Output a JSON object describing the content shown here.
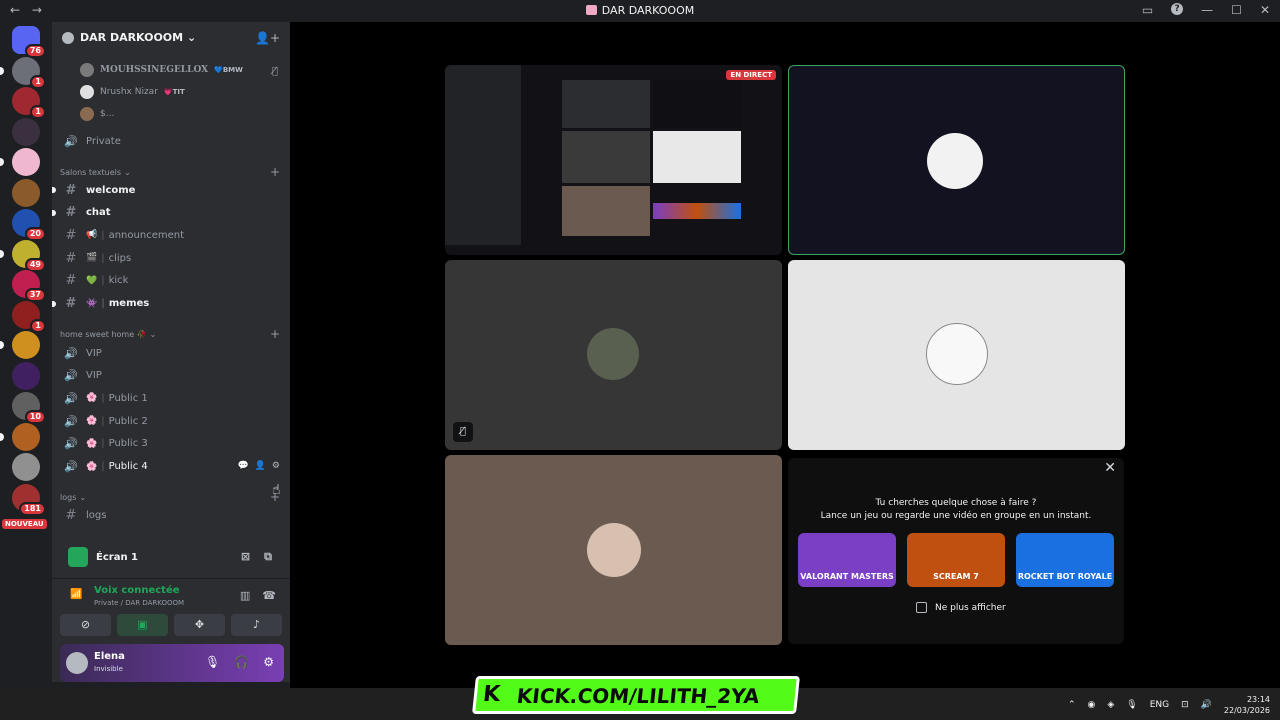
{
  "window": {
    "title": "DAR DARKOOOM",
    "back": "←",
    "forward": "→"
  },
  "servers": [
    {
      "name": "home",
      "badge": "76",
      "color": "#5865f2"
    },
    {
      "name": "server-1",
      "badge": "1",
      "color": "#6d6f78"
    },
    {
      "name": "server-2",
      "badge": "1",
      "color": "#a02830"
    },
    {
      "name": "server-3",
      "badge": "",
      "color": "#3a3040"
    },
    {
      "name": "server-4",
      "badge": "",
      "color": "#f0b8d0"
    },
    {
      "name": "server-5",
      "badge": "",
      "color": "#8a5a2a"
    },
    {
      "name": "server-6",
      "badge": "20",
      "color": "#2050b0"
    },
    {
      "name": "server-7",
      "badge": "49",
      "color": "#c0b030"
    },
    {
      "name": "server-8",
      "badge": "37",
      "color": "#c02050"
    },
    {
      "name": "server-9",
      "badge": "1",
      "color": "#902020"
    },
    {
      "name": "server-10",
      "badge": "",
      "color": "#d09020"
    },
    {
      "name": "server-11",
      "badge": "",
      "color": "#402060"
    },
    {
      "name": "server-12",
      "badge": "10",
      "color": "#606060"
    },
    {
      "name": "server-13",
      "badge": "",
      "color": "#b06020"
    },
    {
      "name": "server-14",
      "badge": "",
      "color": "#909090"
    },
    {
      "name": "server-15",
      "badge": "181",
      "color": "#a03030"
    }
  ],
  "nouveau_label": "NOUVEAU",
  "guild": {
    "name": "DAR DARKOOOM",
    "chevron": "⌄"
  },
  "voice_users": [
    {
      "name": "MOUHSSINEGELLOX",
      "tag": "BMW",
      "heart": "💙"
    },
    {
      "name": "Nrushx Nizar",
      "tag": "TIT",
      "heart": "💗"
    },
    {
      "name": "$...",
      "tag": "",
      "heart": ""
    }
  ],
  "private_channel": "Private",
  "categories": {
    "text": "Salons textuels",
    "home": "home sweet home 🥀",
    "logs": "logs"
  },
  "text_channels": [
    {
      "name": "welcome",
      "emoji": "",
      "unread": true
    },
    {
      "name": "chat",
      "emoji": "",
      "unread": true
    },
    {
      "name": "announcement",
      "emoji": "📢",
      "unread": false
    },
    {
      "name": "clips",
      "emoji": "🎬",
      "unread": false
    },
    {
      "name": "kick",
      "emoji": "💚",
      "unread": false
    },
    {
      "name": "memes",
      "emoji": "👾",
      "unread": true
    }
  ],
  "voice_channels": [
    {
      "name": "VIP",
      "emoji": ""
    },
    {
      "name": "VIP",
      "emoji": ""
    },
    {
      "name": "Public 1",
      "emoji": "🌸"
    },
    {
      "name": "Public 2",
      "emoji": "🌸"
    },
    {
      "name": "Public 3",
      "emoji": "🌸"
    },
    {
      "name": "Public 4",
      "emoji": "🌸"
    }
  ],
  "logs_channel": "logs",
  "screen_share": {
    "label": "Écran 1"
  },
  "voice_status": {
    "title": "Voix connectée",
    "subtitle": "Private / DAR DARKOOOM"
  },
  "user": {
    "name": "Elena",
    "status": "Invisible"
  },
  "stage": {
    "live_badge": "EN DIRECT",
    "activity": {
      "line1": "Tu cherches quelque chose à faire ?",
      "line2": "Lance un jeu ou regarde une vidéo en groupe en un instant.",
      "cards": [
        {
          "title": "VALORANT MASTERS",
          "color": "#7a3fc4"
        },
        {
          "title": "SCREAM 7",
          "color": "#c05010"
        },
        {
          "title": "ROCKET BOT ROYALE",
          "color": "#1a70e0"
        }
      ],
      "checkbox_label": "Ne plus afficher"
    }
  },
  "overlay": {
    "kick_text": "KICK.COM/LILITH_2YA",
    "kick_logo": "K"
  },
  "tray": {
    "lang": "ENG",
    "time": "23:14",
    "date": "22/03/2026"
  },
  "colors": {
    "accent": "#5865f2",
    "green": "#23a55a",
    "kick": "#53fc18",
    "live": "#da373c"
  }
}
